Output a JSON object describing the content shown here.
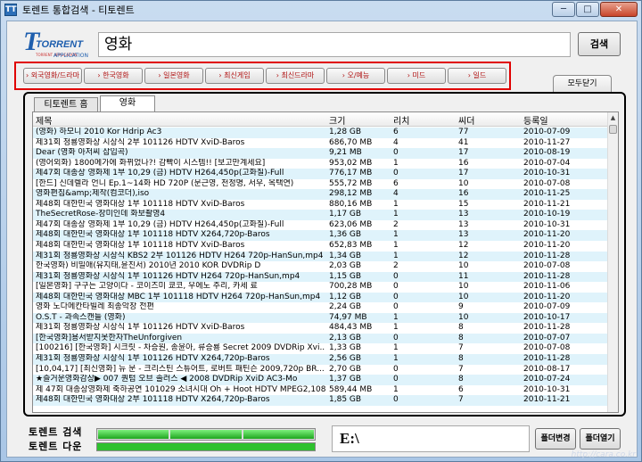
{
  "window": {
    "title": "토렌트 통합검색 - 티토렌트",
    "icon_label": "TT",
    "min": "─",
    "max": "□",
    "close": "✕"
  },
  "logo": {
    "big": "T",
    "word": "TORRENT",
    "app": "APPLICATION",
    "tiny": "TORRENT APPLICATION"
  },
  "search": {
    "query": "영화",
    "button": "검색"
  },
  "categories": [
    "› 외국영화/드라마",
    "› 한국영화",
    "› 일본영화",
    "› 최신게임",
    "› 최신드라마",
    "› 오/예능",
    "› 미드",
    "› 일드"
  ],
  "close_all": "모두닫기",
  "tabs": {
    "home": "티토렌트 홈",
    "active": "영화"
  },
  "columns": {
    "name": "제목",
    "size": "크기",
    "seed": "리치",
    "peer": "씨더",
    "date": "등록일"
  },
  "rows": [
    [
      "(영화) 하모니 2010 Kor Hdrip Ac3",
      "1,28 GB",
      "6",
      "77",
      "2010-07-09"
    ],
    [
      "제31회 청룡영화상 시상식 2부 101126 HDTV XviD-Baros",
      "686,70 MB",
      "4",
      "41",
      "2010-11-27"
    ],
    [
      "Dear (영화 아저씨 삽입곡)",
      "9,21 MB",
      "0",
      "17",
      "2010-08-19"
    ],
    [
      "(영어외화) 1800메가에 화뀌었나?! 감빡이 시스템!! [보고만계세요]",
      "953,02 MB",
      "1",
      "16",
      "2010-07-04"
    ],
    [
      "제47회 대종상 영화제 1부 10,29 (금) HDTV H264,450p(고화질)-Full",
      "776,17 MB",
      "0",
      "17",
      "2010-10-31"
    ],
    [
      "[한드] 신데렐라 언니 Ep.1~14화 HD 720P (문근영, 천정명, 서우, 옥택연)",
      "555,72 MB",
      "6",
      "10",
      "2010-07-08"
    ],
    [
      "영화편집&amp;제작(컴코더),iso",
      "298,12 MB",
      "4",
      "16",
      "2010-11-25"
    ],
    [
      "제48회 대한민국 영화대상 1부 101118 HDTV XviD-Baros",
      "880,16 MB",
      "1",
      "15",
      "2010-11-21"
    ],
    [
      "TheSecretRose-장미인데 화보촬영4",
      "1,17 GB",
      "1",
      "13",
      "2010-10-19"
    ],
    [
      "제47회 대종상 영화제 1부 10,29 (금) HDTV H264,450p(고화질)-Full",
      "623,06 MB",
      "2",
      "13",
      "2010-10-31"
    ],
    [
      "제48회 대한민국 영화대상 1부 101118 HDTV X264,720p-Baros",
      "1,36 GB",
      "1",
      "13",
      "2010-11-20"
    ],
    [
      "제48회 대한민국 영화대상 1부 101118 HDTV XviD-Baros",
      "652,83 MB",
      "1",
      "12",
      "2010-11-20"
    ],
    [
      "제31회 청룡영화상 시상식 KBS2 2부 101126 HDTV H264 720p-HanSun,mp4",
      "1,34 GB",
      "1",
      "12",
      "2010-11-28"
    ],
    [
      "한국영화) 비밀애(유지태,윤진서) 2010년 2010 KOR DVDRip D",
      "2,03 GB",
      "2",
      "10",
      "2010-07-08"
    ],
    [
      "제31회 청룡영화상 시상식 1부 101126 HDTV H264 720p-HanSun,mp4",
      "1,15 GB",
      "0",
      "11",
      "2010-11-28"
    ],
    [
      "[일본영화] 구구는 고양이다 - 코이즈미 쿄코, 우에노 주리, 카세 료",
      "700,28 MB",
      "0",
      "10",
      "2010-11-06"
    ],
    [
      "제48회 대한민국 영화대상 MBC 1부 101118 HDTV H264 720p-HanSun,mp4",
      "1,12 GB",
      "0",
      "10",
      "2010-11-20"
    ],
    [
      "영화 노다메칸타빌레 최종악장 전편",
      "2,24 GB",
      "0",
      "9",
      "2010-07-09"
    ],
    [
      "O.S.T - 과속스캔들 (영화)",
      "74,97 MB",
      "1",
      "10",
      "2010-10-17"
    ],
    [
      "제31회 청룡영화상 시상식 1부 101126 HDTV XviD-Baros",
      "484,43 MB",
      "1",
      "8",
      "2010-11-28"
    ],
    [
      "[한국영화]용서받지못한자TheUnforgiven",
      "2,13 GB",
      "0",
      "8",
      "2010-07-07"
    ],
    [
      "[100216] [한국영화] 시크릿 - 차승원, 송윤아, 류승룡 Secret 2009 DVDRip Xvi...",
      "1,33 GB",
      "1",
      "7",
      "2010-07-08"
    ],
    [
      "제31회 청룡영화상 시상식 1부 101126 HDTV X264,720p-Baros",
      "2,56 GB",
      "1",
      "8",
      "2010-11-28"
    ],
    [
      "[10,04,17] [최신영화] 뉴 문 - 크리스틴 스튜어트, 로버트 패틴슨 2009,720p BR...",
      "2,70 GB",
      "0",
      "7",
      "2010-08-17"
    ],
    [
      "★즐거운영화감상▶ 007 퀀텀 오브 솔러스 ◀ 2008 DVDRip XviD AC3-Mo",
      "1,37 GB",
      "0",
      "8",
      "2010-07-24"
    ],
    [
      "제 47회 대종상영화제 축하공연 101029 소녀시대 Oh + Hoot HDTV MPEG2,1080...",
      "589,44 MB",
      "1",
      "6",
      "2010-10-31"
    ],
    [
      "제48회 대한민국 영화대상 2부 101118 HDTV X264,720p-Baros",
      "1,85 GB",
      "0",
      "7",
      "2010-11-21"
    ]
  ],
  "footer": {
    "label_search": "토렌트 검색",
    "label_download": "토렌트 다운",
    "path": "E:\\",
    "change_folder": "폴더변경",
    "open_folder": "폴더열기",
    "url": "http://cara.co.kr"
  }
}
